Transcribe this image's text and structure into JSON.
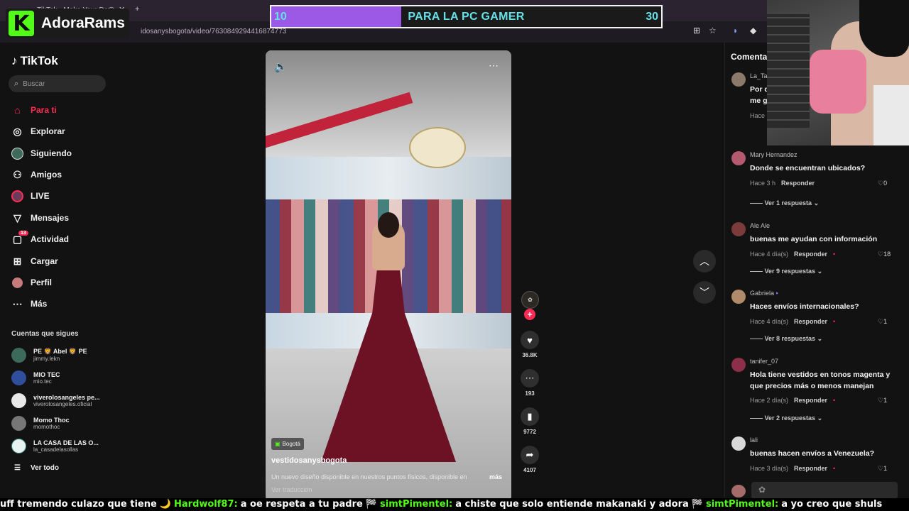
{
  "browser": {
    "tab_title": "TikTok - Make Your Day",
    "url": "idosanysbogota/video/7630849294416874773"
  },
  "stream": {
    "streamer_name": "AdoraRams",
    "logo_letter": "K",
    "goal": {
      "current": "10",
      "target": "30",
      "title": "PARA LA PC GAMER",
      "fraction": 0.333
    }
  },
  "sidebar": {
    "logo": "TikTok",
    "search_placeholder": "Buscar",
    "nav": [
      {
        "label": "Para ti",
        "icon": "home-icon"
      },
      {
        "label": "Explorar",
        "icon": "compass-icon"
      },
      {
        "label": "Siguiendo",
        "icon": "following-avatar-icon"
      },
      {
        "label": "Amigos",
        "icon": "friends-icon"
      },
      {
        "label": "LIVE",
        "icon": "live-icon"
      },
      {
        "label": "Mensajes",
        "icon": "messages-icon"
      },
      {
        "label": "Actividad",
        "icon": "activity-icon",
        "badge": "13"
      },
      {
        "label": "Cargar",
        "icon": "upload-icon"
      },
      {
        "label": "Perfil",
        "icon": "profile-icon"
      },
      {
        "label": "Más",
        "icon": "more-icon"
      }
    ],
    "following_title": "Cuentas que sigues",
    "accounts": [
      {
        "name": "PE 🦁 Abel 🦁 PE",
        "user": "jimmy.lekn",
        "color": "#3d6b5b"
      },
      {
        "name": "MIO TEC",
        "user": "mio.tec",
        "color": "#2f4f9c"
      },
      {
        "name": "viverolosangeles pe...",
        "user": "viverolosangeles.oficial",
        "color": "#e8e8e8"
      },
      {
        "name": "Momo Thoc",
        "user": "momothoc",
        "color": "#777777"
      },
      {
        "name": "LA CASA DE LAS O...",
        "user": "la_casadelasollas",
        "color": "#e8f2f0"
      }
    ],
    "see_all": "Ver todo",
    "see_all_icon": "list-icon"
  },
  "video": {
    "location": "Bogotá",
    "username": "vestidosanysbogota",
    "description": "Un nuevo diseño disponible en nuestros puntos físicos, disponible en",
    "more": "más",
    "translate": "Ver traducción"
  },
  "actions": {
    "likes": "36.8K",
    "comments": "193",
    "saves": "9772",
    "shares": "4107"
  },
  "comments": {
    "title": "Comenta",
    "items": [
      {
        "user": "La_Ta",
        "text": "Por q me g",
        "meta": "Hace",
        "likes": "",
        "replies": "",
        "color": "#8a7a6a"
      },
      {
        "user": "Mary Hernandez",
        "text": "Donde se encuentran ubicados?",
        "meta": "Hace 3 h",
        "reply": "Responder",
        "likes": "0",
        "replies": "Ver 1 respuesta",
        "color": "#b45a6e"
      },
      {
        "user": "Ale Ale",
        "text": "buenas me ayudan con información",
        "meta": "Hace 4 día(s)",
        "reply": "Responder",
        "likes": "18",
        "replies": "Ver 9 respuestas",
        "color": "#7b3b3b"
      },
      {
        "user": "Gabriela",
        "text": "Haces envíos internacionales?",
        "meta": "Hace 4 día(s)",
        "reply": "Responder",
        "likes": "1",
        "replies": "Ver 8 respuestas",
        "color": "#b08b6a"
      },
      {
        "user": "tanifer_07",
        "text": "Hola tiene vestidos en tonos magenta y que precios más o menos manejan",
        "meta": "Hace 2 día(s)",
        "reply": "Responder",
        "likes": "1",
        "replies": "Ver 2 respuestas",
        "color": "#8b2f4a"
      },
      {
        "user": "lali",
        "text": "buenas hacen envíos a Venezuela?",
        "meta": "Hace 3 día(s)",
        "reply": "Responder",
        "likes": "1",
        "replies": "",
        "color": "#d9d9d9"
      }
    ]
  },
  "ticker": [
    {
      "kind": "text",
      "value": "uff tremendo culazo que tiene"
    },
    {
      "kind": "badge",
      "value": "🌙"
    },
    {
      "kind": "user",
      "value": "Hardwolf87:"
    },
    {
      "kind": "text",
      "value": "a oe respeta a tu padre"
    },
    {
      "kind": "badge",
      "value": "🏁"
    },
    {
      "kind": "user",
      "value": "simtPimentel:"
    },
    {
      "kind": "text",
      "value": "a chiste que solo entiende makanaki y adora"
    },
    {
      "kind": "badge",
      "value": "🏁"
    },
    {
      "kind": "user",
      "value": "simtPimentel:"
    },
    {
      "kind": "text",
      "value": "a yo creo que shuls"
    }
  ]
}
